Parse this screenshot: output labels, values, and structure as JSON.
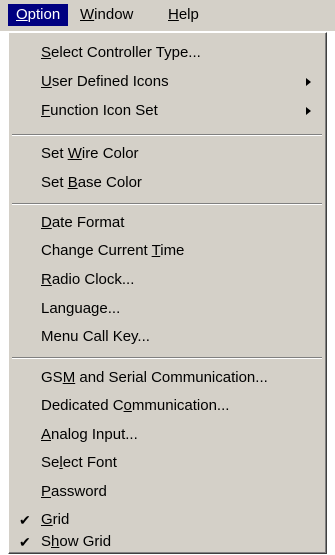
{
  "menubar": {
    "items": [
      {
        "pre": "",
        "key": "O",
        "post": "ption"
      },
      {
        "pre": "",
        "key": "W",
        "post": "indow"
      },
      {
        "pre": "",
        "key": "H",
        "post": "elp"
      }
    ]
  },
  "menu": {
    "group1": [
      {
        "pre": "",
        "key": "S",
        "post": "elect Controller Type..."
      },
      {
        "pre": "",
        "key": "U",
        "post": "ser Defined Icons"
      },
      {
        "pre": "",
        "key": "F",
        "post": "unction Icon Set"
      }
    ],
    "group2": [
      {
        "pre": "Set ",
        "key": "W",
        "post": "ire Color"
      },
      {
        "pre": "Set ",
        "key": "B",
        "post": "ase Color"
      }
    ],
    "group3": [
      {
        "pre": "",
        "key": "D",
        "post": "ate Format"
      },
      {
        "pre": "Change Current ",
        "key": "T",
        "post": "ime"
      },
      {
        "pre": "",
        "key": "R",
        "post": "adio Clock..."
      },
      {
        "pre": "Language...",
        "key": "",
        "post": ""
      },
      {
        "pre": "Menu Call Key...",
        "key": "",
        "post": ""
      }
    ],
    "group4": [
      {
        "pre": "GS",
        "key": "M",
        "post": " and Serial Communication..."
      },
      {
        "pre": "Dedicated C",
        "key": "o",
        "post": "mmunication..."
      },
      {
        "pre": "",
        "key": "A",
        "post": "nalog Input..."
      },
      {
        "pre": "Se",
        "key": "l",
        "post": "ect Font"
      },
      {
        "pre": "",
        "key": "P",
        "post": "assword"
      },
      {
        "pre": "",
        "key": "G",
        "post": "rid"
      },
      {
        "pre": "S",
        "key": "h",
        "post": "ow Grid"
      }
    ],
    "check_glyph": "✔"
  }
}
